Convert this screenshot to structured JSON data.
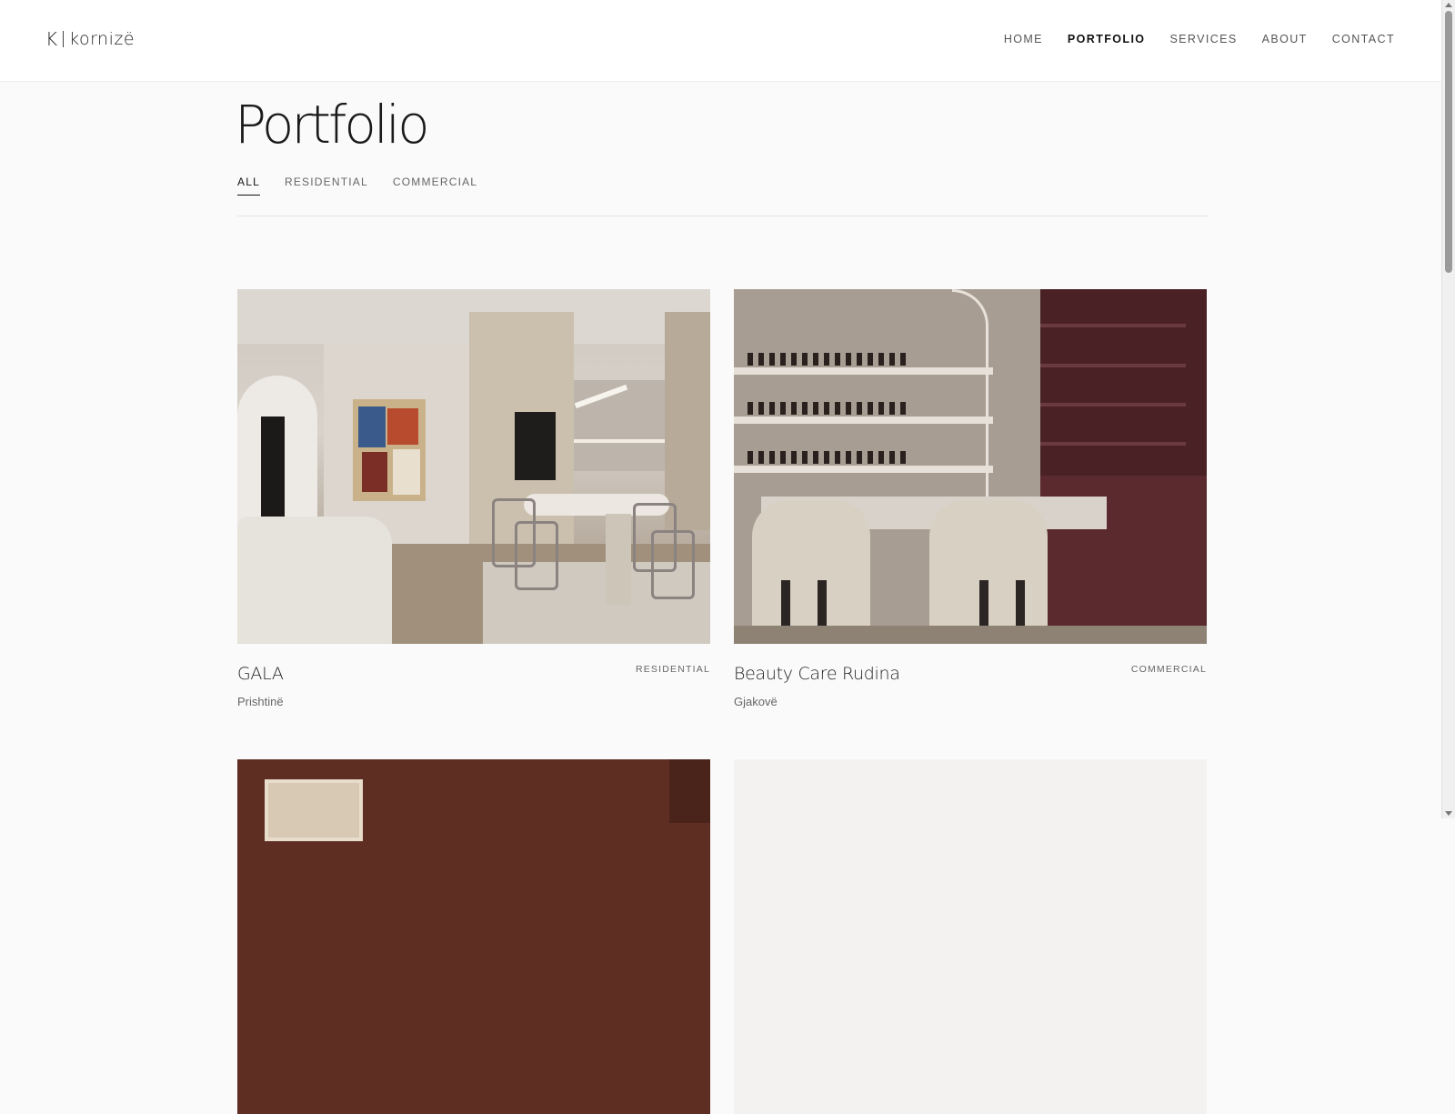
{
  "header": {
    "logo_mark": "K",
    "logo_text": "kornizë",
    "nav": [
      {
        "label": "HOME",
        "active": false
      },
      {
        "label": "PORTFOLIO",
        "active": true
      },
      {
        "label": "SERVICES",
        "active": false
      },
      {
        "label": "ABOUT",
        "active": false
      },
      {
        "label": "CONTACT",
        "active": false
      }
    ]
  },
  "page": {
    "title": "Portfolio",
    "tabs": [
      {
        "label": "ALL",
        "active": true
      },
      {
        "label": "RESIDENTIAL",
        "active": false
      },
      {
        "label": "COMMERCIAL",
        "active": false
      }
    ]
  },
  "projects": [
    {
      "title": "GALA",
      "category": "RESIDENTIAL",
      "location": "Prishtinë"
    },
    {
      "title": "Beauty Care Rudina",
      "category": "COMMERCIAL",
      "location": "Gjakovë"
    }
  ],
  "colors": {
    "accent": "#111111",
    "muted": "#666666",
    "background": "#fafafa"
  }
}
